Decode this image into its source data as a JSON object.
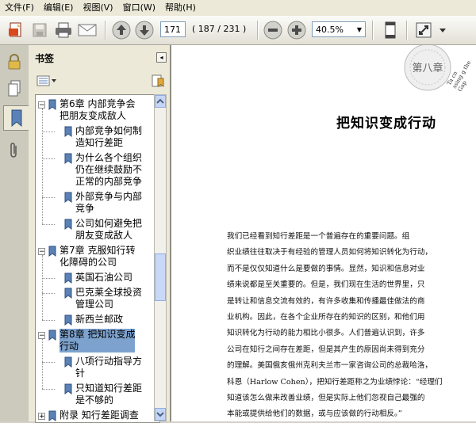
{
  "menubar": {
    "items": [
      "文件(F)",
      "编辑(E)",
      "视图(V)",
      "窗口(W)",
      "帮助(H)"
    ]
  },
  "toolbar": {
    "page_current": "171",
    "page_count": "( 187 / 231 )",
    "zoom": "40.5%",
    "icons": [
      "create-pdf-icon",
      "save-icon",
      "print-icon",
      "email-icon",
      "prev-page-icon",
      "next-page-icon",
      "zoom-out-icon",
      "zoom-in-icon",
      "fit-page-icon",
      "fit-width-icon",
      "options-icon"
    ]
  },
  "panel": {
    "title": "书签",
    "close_glyph": "◂",
    "tree": [
      {
        "label_lines": [
          "第6章 内部竞争会",
          "把朋友变成敌人"
        ],
        "level": 0,
        "expanded": true
      },
      {
        "label_lines": [
          "内部竞争如何制",
          "造知行差距"
        ],
        "level": 1
      },
      {
        "label_lines": [
          "为什么各个组织",
          "仍在继续鼓励不",
          "正常的内部竞争"
        ],
        "level": 1
      },
      {
        "label_lines": [
          "外部竞争与内部",
          "竞争"
        ],
        "level": 1
      },
      {
        "label_lines": [
          "公司如何避免把",
          "朋友变成敌人"
        ],
        "level": 1
      },
      {
        "label_lines": [
          "第7章 克服知行转",
          "化障碍的公司"
        ],
        "level": 0,
        "expanded": true
      },
      {
        "label_lines": [
          "英国石油公司"
        ],
        "level": 1
      },
      {
        "label_lines": [
          "巴克莱全球投资",
          "管理公司"
        ],
        "level": 1
      },
      {
        "label_lines": [
          "新西兰邮政"
        ],
        "level": 1
      },
      {
        "label_lines": [
          "第8章 把知识变成",
          "行动"
        ],
        "level": 0,
        "expanded": true,
        "selected": true
      },
      {
        "label_lines": [
          "八项行动指导方",
          "针"
        ],
        "level": 1
      },
      {
        "label_lines": [
          "只知道知行差距",
          "是不够的"
        ],
        "level": 1
      },
      {
        "label_lines": [
          "附录 知行差距调查"
        ],
        "level": 0
      }
    ]
  },
  "document": {
    "seal_text": "第八章",
    "seal_side": "Ta cn ssing g the Gap",
    "chapter_title": "把知识变成行动",
    "paragraph_lines": [
      "我们已经看到知行差距是一个普遍存在的重要问题。组",
      "织业绩往往取决于有经验的管理人员如何将知识转化为行动，",
      "而不是仅仅知道什么是要做的事情。显然，知识和信息对业",
      "绩来说都是至关重要的。但是，我们现在生活的世界里，只",
      "是转让和信息交流有效的，有许多收集和传播最佳做法的商",
      "业机构。因此，在各个企业所存在的知识的区别，和他们用",
      "知识转化为行动的能力相比小很多。人们普遍认识到，许多",
      "公司在知行之间存在差距，但是其产生的原因尚未得到充分",
      "的理解。美国俄亥俄州克利夫兰市一家咨询公司的总裁哈洛，",
      "科恩（Harlow Cohen），把知行差距称之为业绩悖论：“经理们",
      "知道该怎么做来改善业绩，但是实际上他们忽视自己最强的",
      "本能或提供给他们的数据，或与应该做的行动相反。”"
    ]
  }
}
